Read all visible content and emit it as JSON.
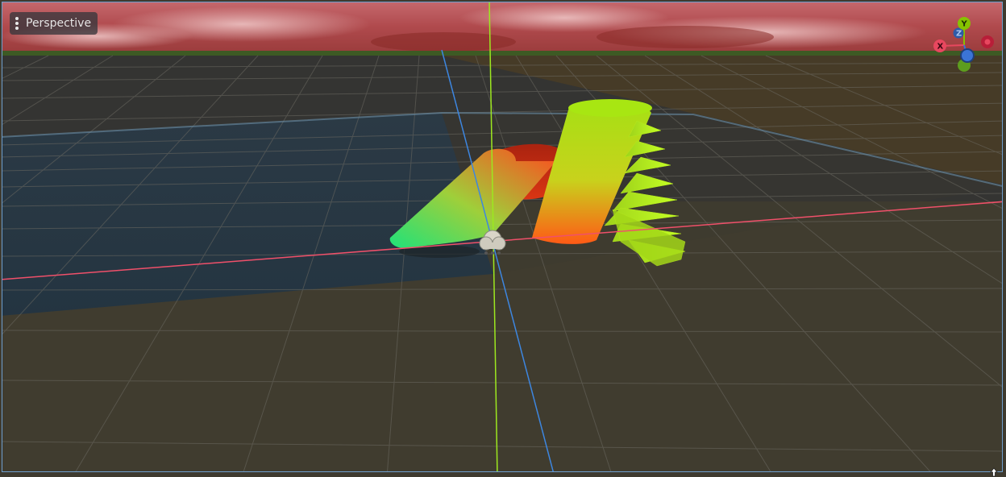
{
  "viewport": {
    "view_menu_label": "Perspective",
    "projection": "perspective"
  },
  "gizmo": {
    "x_label": "X",
    "y_label": "Y",
    "z_label": "Z",
    "x_color": "#e8475f",
    "y_color": "#86c300",
    "z_color": "#3b74d6"
  },
  "axis_colors": {
    "x_axis": "#f0506a",
    "y_axis": "#9de81f",
    "z_axis": "#3d86e0"
  },
  "icons": {
    "view_menu": "kebab-vertical-icon",
    "light_node": "light-gizmo-icon",
    "resize": "resize-cursor-icon"
  }
}
